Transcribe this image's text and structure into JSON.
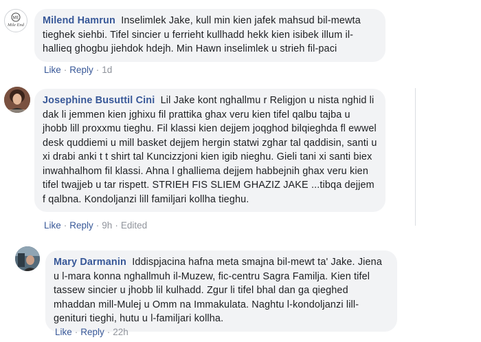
{
  "comments": [
    {
      "author": "Milend Hamrun",
      "avatar_text": "Mile End",
      "text": "Inselimlek Jake, kull min kien jafek mahsud bil-mewta tieghek siehbi. Tifel sincier u ferrieht kullhadd hekk kien isibek illum il-hallieq ghogbu jiehdok hdejh. Min Hawn inselimlek u strieh fil-paci",
      "like": "Like",
      "reply": "Reply",
      "time": "1d",
      "edited": ""
    },
    {
      "author": "Josephine Busuttil Cini",
      "avatar_text": "",
      "text": "Lil Jake kont nghallmu r Religjon u nista nghid li dak li jemmen kien jghixu fil prattika ghax veru kien tifel qalbu tajba u jhobb lill proxxmu tieghu. Fil klassi kien dejjem joqghod bilqieghda fl ewwel desk quddiemi u mill basket dejjem hergin statwi zghar tal qaddisin, santi u xi drabi anki t t shirt tal Kuncizzjoni kien igib nieghu. Gieli tani xi santi biex inwahhalhom fil klassi. Ahna l ghalliema dejjem habbejnih ghax veru kien tifel twajjeb u tar rispett. STRIEH FIS SLIEM GHAZIZ JAKE ...tibqa dejjem f qalbna. Kondoljanzi lill familjari kollha tieghu.",
      "like": "Like",
      "reply": "Reply",
      "time": "9h",
      "edited": "Edited"
    },
    {
      "author": "Mary Darmanin",
      "avatar_text": "",
      "text": "Iddispjacina hafna meta smajna bil-mewt ta' Jake. Jiena u l-mara konna nghallmuh il-Muzew, fic-centru Sagra Familja. Kien tifel tassew sincier u jhobb lil kulhadd. Zgur li tifel bhal dan ga qieghed mhaddan mill-Mulej u Omm na Immakulata. Naghtu l-kondoljanzi lill-genituri tieghi, hutu u l-familjari kollha.",
      "like": "Like",
      "reply": "Reply",
      "time": "22h",
      "edited": ""
    }
  ],
  "colors": {
    "name": "#385898",
    "bubble": "#f2f3f5",
    "meta": "#90949c"
  }
}
